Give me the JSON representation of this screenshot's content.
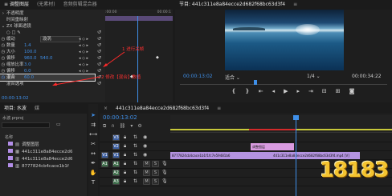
{
  "effect_controls": {
    "tabs": [
      "调整图层",
      "(无素材)",
      "音频剪辑混合器"
    ],
    "header_clip": "441c311e8a84ecce2d682f68bc63d3f4",
    "ruler_time": ":00:00",
    "ruler_time_end": "00:00:1",
    "rows": [
      {
        "label": "不透明度",
        "value": "",
        "extra": ""
      },
      {
        "label": "时间重映射",
        "value": "",
        "extra": ""
      },
      {
        "label": "ZX 球面透镜",
        "value": "",
        "extra": ""
      },
      {
        "label": "",
        "value": "",
        "extra": ""
      },
      {
        "label": "缓动",
        "value": "",
        "extra": "漩涡"
      },
      {
        "label": "数量",
        "value": "1.4",
        "extra": ""
      },
      {
        "label": "大小",
        "value": "100.0",
        "extra": ""
      },
      {
        "label": "偏移",
        "value": "960.0",
        "extra": "540.0"
      },
      {
        "label": "缩放比率",
        "value": "3.0",
        "extra": ""
      },
      {
        "label": "偏移",
        "value": "0.0",
        "extra": ""
      },
      {
        "label": "混合",
        "value": "60.0",
        "extra": ""
      },
      {
        "label": "混合选项",
        "value": "",
        "extra": ""
      }
    ],
    "annotation_1": "1 进行关帧",
    "annotation_2": "2 修改【混合】数值",
    "timecode": "00:00:13:02"
  },
  "program_monitor": {
    "title": "节目: 441c311e8a84ecce2d682f68bc63d3f4",
    "timecode": "00:00:13:02",
    "fit": "适合",
    "quality": "1/4",
    "duration": "00:00:34:22"
  },
  "project": {
    "tabs": [
      "项目: 水波",
      "媒"
    ],
    "project_file": "水波.prproj",
    "name_header": "名称",
    "items": [
      {
        "name": "调整图层",
        "color": "#b38ee8"
      },
      {
        "name": "441c311e8a84ecce2d6",
        "color": "#b38ee8"
      },
      {
        "name": "441c311e8a84ecce2d6",
        "color": "#b38ee8"
      },
      {
        "name": "8777824cb4cace1b1f",
        "color": "#b38ee8"
      }
    ]
  },
  "timeline": {
    "tab": "441c311e8a84ecce2d682f68bc63d3f4",
    "timecode": "00:00:13:02",
    "tracks": [
      {
        "id": "V3",
        "kind": "video",
        "buttons": [
          "V3"
        ]
      },
      {
        "id": "V2",
        "kind": "video",
        "buttons": [
          "V2"
        ]
      },
      {
        "id": "V1",
        "kind": "video",
        "buttons": [
          "V1",
          "V1"
        ]
      },
      {
        "id": "A1",
        "kind": "audio",
        "buttons": [
          "A1",
          "A1",
          "M",
          "S"
        ]
      },
      {
        "id": "A2",
        "kind": "audio",
        "buttons": [
          "A2",
          "M",
          "S"
        ]
      },
      {
        "id": "A3",
        "kind": "audio",
        "buttons": [
          "A3",
          "M",
          "S"
        ]
      }
    ],
    "clips": {
      "adjust_label": "调整图层",
      "v1_a_label": "8777824cb4cace1b1f1fc7e59481b6",
      "v1_b_label": "441c311e8a84ecce2d682f68bc63d3f4.mp4 [V]"
    }
  },
  "watermark": "18183"
}
